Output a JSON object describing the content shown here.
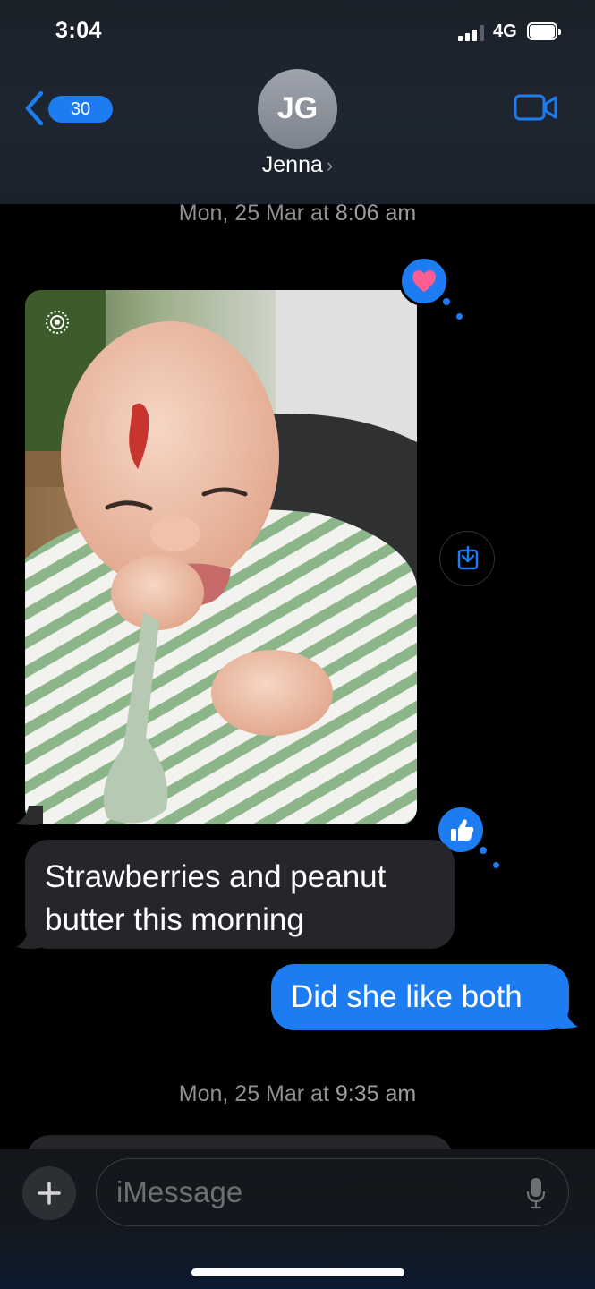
{
  "status_bar": {
    "time": "3:04",
    "network": "4G",
    "signal_bars_active": 3,
    "signal_bars_total": 4,
    "battery_level": 1.0
  },
  "header": {
    "back_count": "30",
    "back_icon": "chevron-left-icon",
    "avatar_initials": "JG",
    "contact_name": "Jenna",
    "contact_chevron": "›",
    "video_icon": "video-camera-icon",
    "accent_color": "#1d7cf2"
  },
  "conversation": {
    "timestamp_1_day": "Mon, 25 Mar at ",
    "timestamp_1_time": "8:06 am",
    "photo_reaction_icon": "heart-icon",
    "photo_reaction_color": "#ff5d8f",
    "save_icon": "save-download-icon",
    "incoming_message": "Strawberries and peanut butter this morning",
    "incoming_reaction_icon": "thumbs-up-icon",
    "outgoing_message": "Did she like both",
    "timestamp_2_day": "Mon, 25 Mar at ",
    "timestamp_2_time": "9:35 am"
  },
  "composer": {
    "plus_icon": "plus-icon",
    "placeholder": "iMessage",
    "mic_icon": "microphone-icon"
  }
}
